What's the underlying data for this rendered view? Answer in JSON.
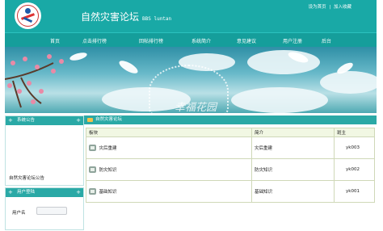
{
  "header": {
    "title": "自然灾害论坛",
    "subtitle": "BBS luntan",
    "links": [
      "设为首页",
      "|",
      "加入收藏"
    ]
  },
  "nav": {
    "items": [
      "首页",
      "点击排行榜",
      "回帖排行榜",
      "系统简介",
      "意见建议",
      "用户注册",
      "后台"
    ]
  },
  "banner": {
    "text": "幸福花园"
  },
  "sidebar": {
    "notice_title": "系统公告",
    "notice_text": "自然灾害论坛公告",
    "login_title": "用户登陆",
    "username_label": "用户名"
  },
  "main": {
    "title": "自然灾害论坛",
    "columns": [
      "板块",
      "简介",
      "斑主"
    ],
    "rows": [
      {
        "name": "灾后重建",
        "intro": "灾后重建",
        "moderator": "yk003"
      },
      {
        "name": "防灾知识",
        "intro": "防灾知识",
        "moderator": "yk002"
      },
      {
        "name": "基础知识",
        "intro": "基础知识",
        "moderator": "yk001"
      }
    ]
  },
  "colors": {
    "brand": "#19a9a6",
    "nav": "#159e9b",
    "panel_header": "#2aa9a6",
    "table_header": "#f1f7e3"
  }
}
